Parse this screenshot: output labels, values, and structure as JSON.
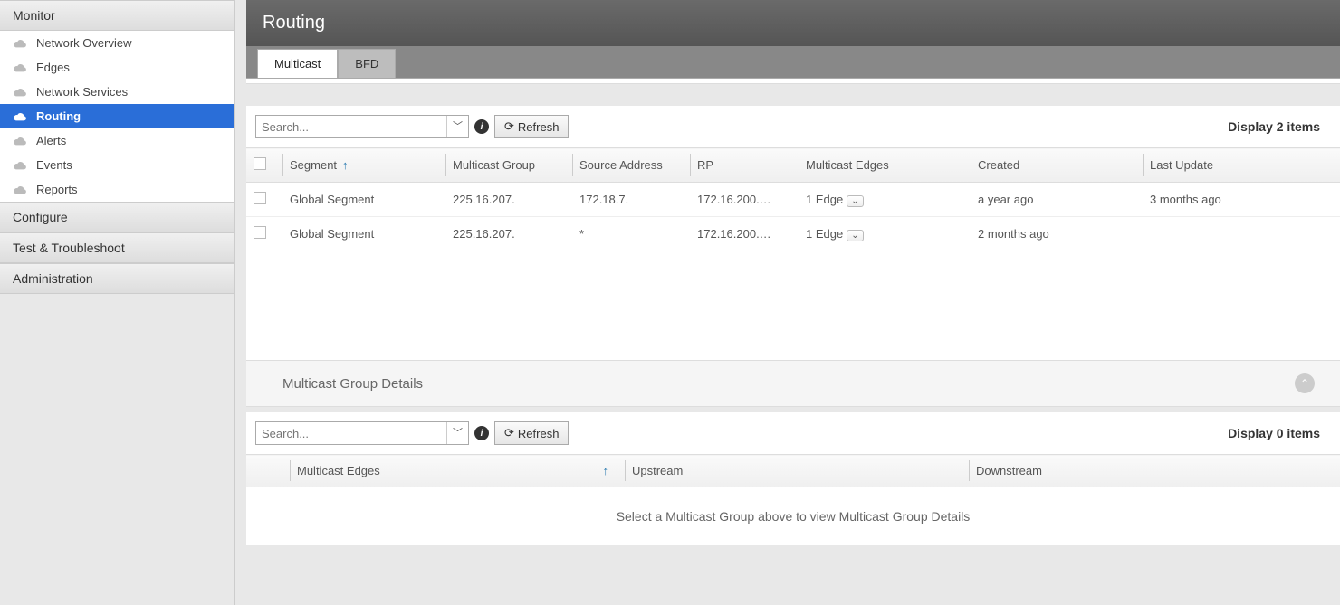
{
  "sidebar": {
    "sections": [
      {
        "label": "Monitor",
        "items": [
          {
            "label": "Network Overview"
          },
          {
            "label": "Edges"
          },
          {
            "label": "Network Services"
          },
          {
            "label": "Routing",
            "active": true
          },
          {
            "label": "Alerts"
          },
          {
            "label": "Events"
          },
          {
            "label": "Reports"
          }
        ]
      },
      {
        "label": "Configure"
      },
      {
        "label": "Test & Troubleshoot"
      },
      {
        "label": "Administration"
      }
    ]
  },
  "page": {
    "title": "Routing"
  },
  "tabs": [
    {
      "label": "Multicast",
      "active": true
    },
    {
      "label": "BFD"
    }
  ],
  "toolbar": {
    "search_placeholder": "Search...",
    "refresh_label": "Refresh",
    "display_label": "Display 2 items"
  },
  "columns": {
    "segment": "Segment",
    "multicast_group": "Multicast Group",
    "source_address": "Source Address",
    "rp": "RP",
    "multicast_edges": "Multicast Edges",
    "created": "Created",
    "last_update": "Last Update"
  },
  "rows": [
    {
      "segment": "Global Segment",
      "multicast_group": "225.16.207.",
      "source_address": "172.18.7.",
      "rp": "172.16.200.…",
      "multicast_edges": "1 Edge",
      "created": "a year ago",
      "last_update": "3 months ago"
    },
    {
      "segment": "Global Segment",
      "multicast_group": "225.16.207.",
      "source_address": "*",
      "rp": "172.16.200.…",
      "multicast_edges": "1 Edge",
      "created": "2 months ago",
      "last_update": ""
    }
  ],
  "details": {
    "title": "Multicast Group Details",
    "search_placeholder": "Search...",
    "refresh_label": "Refresh",
    "display_label": "Display 0 items",
    "columns": {
      "multicast_edges": "Multicast Edges",
      "upstream": "Upstream",
      "downstream": "Downstream"
    },
    "empty_msg": "Select a Multicast Group above to view Multicast Group Details"
  }
}
